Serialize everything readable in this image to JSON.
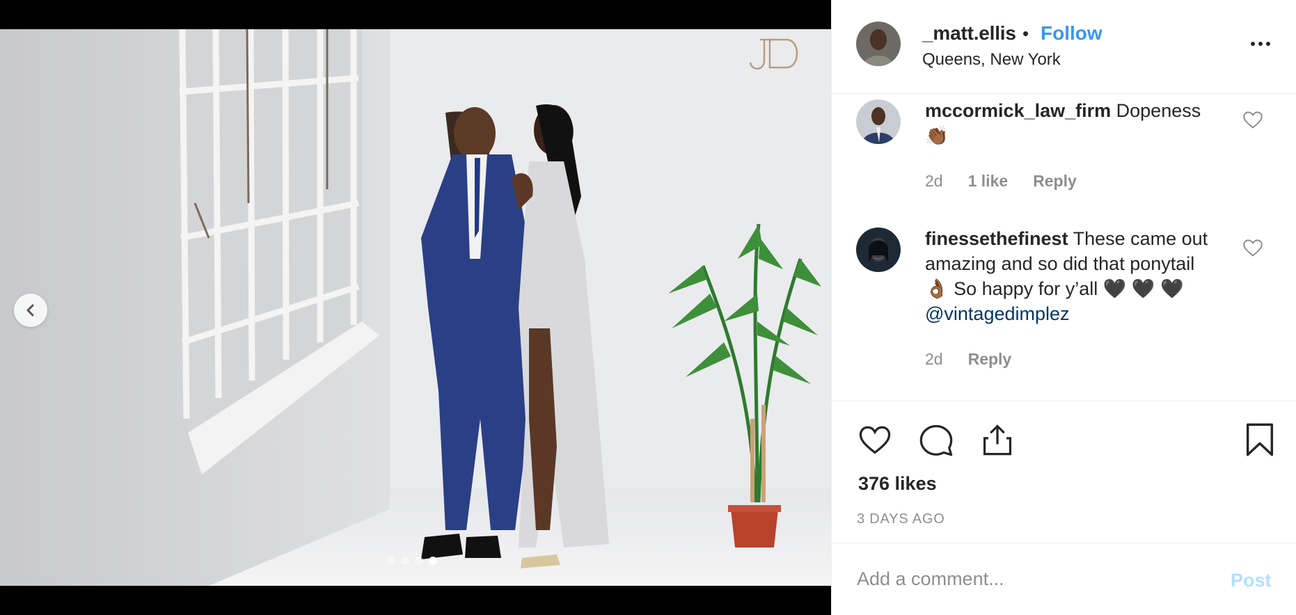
{
  "post": {
    "username": "_matt.ellis",
    "separator": "•",
    "follow_label": "Follow",
    "location": "Queens, New York",
    "watermark": "JD",
    "carousel": {
      "slide_count": 4,
      "active_slide": 4
    }
  },
  "comments": [
    {
      "username": "mccormick_law_firm",
      "text": "Dopeness",
      "emoji": "👏🏾",
      "age": "2d",
      "likes": "1 like",
      "reply_label": "Reply"
    },
    {
      "username": "finessethefinest",
      "text_1": "These came out amazing and so did that ponytail",
      "emoji_1": "👌🏾",
      "text_2": "So happy for y’all",
      "emoji_2": "🖤",
      "emoji_3": "🖤",
      "emoji_4": "🖤",
      "mention": "@vintagedimplez",
      "age": "2d",
      "reply_label": "Reply"
    }
  ],
  "stats": {
    "likes": "376 likes",
    "posted": "3 DAYS AGO"
  },
  "add_comment": {
    "placeholder": "Add a comment...",
    "post_label": "Post"
  },
  "colors": {
    "link_blue": "#3897f0",
    "mention_blue": "#003569",
    "muted": "#8e8e8e",
    "post_disabled": "#b2dffc",
    "text": "#262626"
  },
  "icons": [
    "chevron-left-icon",
    "more-icon",
    "heart-icon",
    "comment-icon",
    "share-icon",
    "bookmark-icon"
  ]
}
